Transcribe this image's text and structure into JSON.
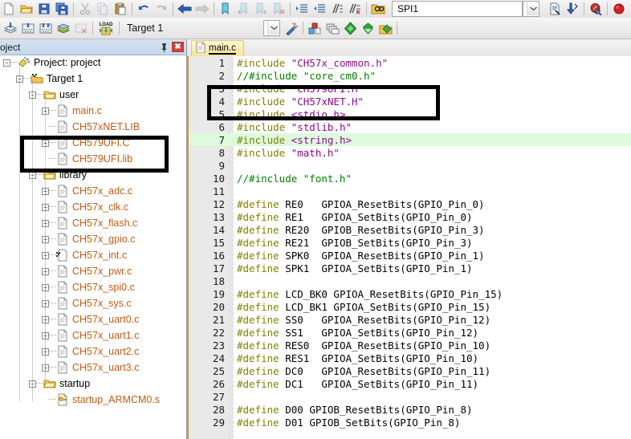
{
  "toolbar_top": {
    "groups": [
      {
        "name": "file",
        "buttons": [
          {
            "name": "new-file-icon",
            "title": "New",
            "icon": "page"
          },
          {
            "name": "open-folder-icon",
            "title": "Open",
            "icon": "folder"
          },
          {
            "name": "save-icon",
            "title": "Save",
            "icon": "floppy"
          },
          {
            "name": "save-all-icon",
            "title": "Save All",
            "icon": "floppy-multi"
          }
        ]
      },
      {
        "name": "clipboard",
        "buttons": [
          {
            "name": "cut-icon",
            "title": "Cut",
            "icon": "scissors"
          },
          {
            "name": "copy-icon",
            "title": "Copy",
            "icon": "copy"
          },
          {
            "name": "paste-icon",
            "title": "Paste",
            "icon": "paste"
          }
        ]
      },
      {
        "name": "history",
        "buttons": [
          {
            "name": "undo-icon",
            "title": "Undo",
            "icon": "undo"
          },
          {
            "name": "redo-icon",
            "title": "Redo",
            "icon": "redo"
          }
        ]
      },
      {
        "name": "navigate",
        "buttons": [
          {
            "name": "navigate-back-icon",
            "title": "Back",
            "icon": "arrow-left"
          },
          {
            "name": "navigate-forward-icon",
            "title": "Forward",
            "icon": "arrow-right"
          }
        ]
      },
      {
        "name": "bookmarks",
        "buttons": [
          {
            "name": "toggle-bookmark-icon",
            "title": "Insert/Remove Bookmark",
            "icon": "bookmark"
          },
          {
            "name": "prev-bookmark-icon",
            "title": "Previous Bookmark",
            "icon": "bookmark-prev"
          },
          {
            "name": "next-bookmark-icon",
            "title": "Next Bookmark",
            "icon": "bookmark-next"
          },
          {
            "name": "clear-bookmarks-icon",
            "title": "Clear All Bookmarks",
            "icon": "bookmark-clear"
          }
        ]
      },
      {
        "name": "indent",
        "buttons": [
          {
            "name": "indent-icon",
            "title": "Indent",
            "icon": "indent"
          },
          {
            "name": "outdent-icon",
            "title": "Outdent",
            "icon": "outdent"
          },
          {
            "name": "comment-icon",
            "title": "Comment",
            "icon": "comment"
          },
          {
            "name": "uncomment-icon",
            "title": "Uncomment",
            "icon": "uncomment"
          }
        ]
      },
      {
        "name": "find",
        "buttons": [
          {
            "name": "find-in-files-icon",
            "title": "Find in Files",
            "icon": "binoculars"
          }
        ]
      }
    ],
    "search_value": "SPI1",
    "search_placeholder": "",
    "right_buttons": [
      {
        "name": "browse-symbol-icon",
        "title": "Browse Code",
        "icon": "doc-search"
      },
      {
        "name": "go-to-definition-icon",
        "title": "Go To Definition",
        "icon": "goto-def"
      },
      {
        "name": "debug-search-icon",
        "title": "Find Symbol",
        "icon": "q-search"
      },
      {
        "name": "stop-icon",
        "title": "Stop",
        "icon": "stop-red"
      }
    ]
  },
  "toolbar_second": {
    "buttons": [
      {
        "name": "build-icon",
        "title": "Translate",
        "icon": "translate"
      },
      {
        "name": "build-target-icon",
        "title": "Build",
        "icon": "build"
      },
      {
        "name": "rebuild-icon",
        "title": "Rebuild",
        "icon": "rebuild"
      },
      {
        "name": "batch-build-icon",
        "title": "Batch Build",
        "icon": "batch"
      },
      {
        "name": "stop-build-icon",
        "title": "Stop Build",
        "icon": "stop-build"
      },
      {
        "name": "download-icon",
        "title": "Download",
        "icon": "load"
      }
    ],
    "target_label": "Target 1",
    "after_combo_buttons": [
      {
        "name": "target-options-icon",
        "title": "Configure Target",
        "icon": "wand"
      },
      {
        "name": "manage-components-icon",
        "title": "Manage Components",
        "icon": "components"
      },
      {
        "name": "multi-project-icon",
        "title": "Multi-Project",
        "icon": "multi"
      },
      {
        "name": "pack-installer-icon",
        "title": "Pack Installer",
        "icon": "diamond"
      },
      {
        "name": "manage-rte-icon",
        "title": "Manage Run-Time Env",
        "icon": "rte"
      },
      {
        "name": "pack-browse-icon",
        "title": "Select Software Packs",
        "icon": "packs"
      }
    ]
  },
  "project_panel": {
    "title": "roject",
    "pin_icon": "pin-icon",
    "close_icon": "close-icon",
    "tree": [
      {
        "depth": 0,
        "label": "Project: project",
        "expander": "minus",
        "icon": "project",
        "type": "root"
      },
      {
        "depth": 1,
        "label": "Target 1",
        "expander": "minus",
        "icon": "target",
        "type": "target"
      },
      {
        "depth": 2,
        "label": "user",
        "expander": "minus",
        "icon": "folder",
        "type": "group"
      },
      {
        "depth": 3,
        "label": "main.c",
        "expander": "plus",
        "icon": "file",
        "type": "source"
      },
      {
        "depth": 3,
        "label": "CH57xNET.LIB",
        "expander": "none",
        "icon": "file",
        "type": "source"
      },
      {
        "depth": 3,
        "label": "CH579UFI.C",
        "expander": "plus",
        "icon": "file",
        "type": "source"
      },
      {
        "depth": 3,
        "label": "CH579UFI.lib",
        "expander": "none",
        "icon": "file",
        "type": "source"
      },
      {
        "depth": 2,
        "label": "library",
        "expander": "minus",
        "icon": "folder",
        "type": "group"
      },
      {
        "depth": 3,
        "label": "CH57x_adc.c",
        "expander": "plus",
        "icon": "file",
        "type": "source"
      },
      {
        "depth": 3,
        "label": "CH57x_clk.c",
        "expander": "plus",
        "icon": "file",
        "type": "source"
      },
      {
        "depth": 3,
        "label": "CH57x_flash.c",
        "expander": "plus",
        "icon": "file",
        "type": "source"
      },
      {
        "depth": 3,
        "label": "CH57x_gpio.c",
        "expander": "plus",
        "icon": "file",
        "type": "source"
      },
      {
        "depth": 3,
        "label": "CH57x_int.c",
        "expander": "plus",
        "icon": "file-target",
        "type": "source"
      },
      {
        "depth": 3,
        "label": "CH57x_pwr.c",
        "expander": "plus",
        "icon": "file",
        "type": "source"
      },
      {
        "depth": 3,
        "label": "CH57x_spi0.c",
        "expander": "plus",
        "icon": "file",
        "type": "source"
      },
      {
        "depth": 3,
        "label": "CH57x_sys.c",
        "expander": "plus",
        "icon": "file",
        "type": "source"
      },
      {
        "depth": 3,
        "label": "CH57x_uart0.c",
        "expander": "plus",
        "icon": "file",
        "type": "source"
      },
      {
        "depth": 3,
        "label": "CH57x_uart1.c",
        "expander": "plus",
        "icon": "file",
        "type": "source"
      },
      {
        "depth": 3,
        "label": "CH57x_uart2.c",
        "expander": "plus",
        "icon": "file",
        "type": "source"
      },
      {
        "depth": 3,
        "label": "CH57x_uart3.c",
        "expander": "plus",
        "icon": "file",
        "type": "source"
      },
      {
        "depth": 2,
        "label": "startup",
        "expander": "minus",
        "icon": "folder",
        "type": "group"
      },
      {
        "depth": 3,
        "label": "startup_ARMCM0.s",
        "expander": "none",
        "icon": "file-asm",
        "type": "asm"
      }
    ]
  },
  "editor": {
    "tab_label": "main.c",
    "tab_icon": "file-icon",
    "highlight_line": 7,
    "lines": [
      {
        "n": 1,
        "tokens": [
          {
            "t": "#include ",
            "c": "pp"
          },
          {
            "t": "\"CH57x_common.h\"",
            "c": "str"
          }
        ]
      },
      {
        "n": 2,
        "tokens": [
          {
            "t": "//#include \"core_cm0.h\"",
            "c": "cmt"
          }
        ]
      },
      {
        "n": 3,
        "tokens": [
          {
            "t": "#include ",
            "c": "pp"
          },
          {
            "t": "\"CH579UFI.H\"",
            "c": "str"
          }
        ]
      },
      {
        "n": 4,
        "tokens": [
          {
            "t": "#include ",
            "c": "pp"
          },
          {
            "t": "\"CH57xNET.H\"",
            "c": "str"
          }
        ]
      },
      {
        "n": 5,
        "tokens": [
          {
            "t": "#include ",
            "c": "pp"
          },
          {
            "t": "<stdio.h>",
            "c": "str"
          }
        ]
      },
      {
        "n": 6,
        "tokens": [
          {
            "t": "#include ",
            "c": "pp"
          },
          {
            "t": "\"stdlib.h\"",
            "c": "str"
          }
        ]
      },
      {
        "n": 7,
        "tokens": [
          {
            "t": "#include ",
            "c": "pp"
          },
          {
            "t": "<string.h>",
            "c": "str"
          }
        ]
      },
      {
        "n": 8,
        "tokens": [
          {
            "t": "#include ",
            "c": "pp"
          },
          {
            "t": "\"math.h\"",
            "c": "str"
          }
        ]
      },
      {
        "n": 9,
        "tokens": []
      },
      {
        "n": 10,
        "tokens": [
          {
            "t": "//#include \"font.h\"",
            "c": "cmt"
          }
        ]
      },
      {
        "n": 11,
        "tokens": []
      },
      {
        "n": 12,
        "tokens": [
          {
            "t": "#define ",
            "c": "pp"
          },
          {
            "t": "RE0   GPIOA_ResetBits(GPIO_Pin_0)",
            "c": "txt"
          }
        ]
      },
      {
        "n": 13,
        "tokens": [
          {
            "t": "#define ",
            "c": "pp"
          },
          {
            "t": "RE1   GPIOA_SetBits(GPIO_Pin_0)",
            "c": "txt"
          }
        ]
      },
      {
        "n": 14,
        "tokens": [
          {
            "t": "#define ",
            "c": "pp"
          },
          {
            "t": "RE20  GPIOB_ResetBits(GPIO_Pin_3)",
            "c": "txt"
          }
        ]
      },
      {
        "n": 15,
        "tokens": [
          {
            "t": "#define ",
            "c": "pp"
          },
          {
            "t": "RE21  GPIOB_SetBits(GPIO_Pin_3)",
            "c": "txt"
          }
        ]
      },
      {
        "n": 16,
        "tokens": [
          {
            "t": "#define ",
            "c": "pp"
          },
          {
            "t": "SPK0  GPIOA_ResetBits(GPIO_Pin_1)",
            "c": "txt"
          }
        ]
      },
      {
        "n": 17,
        "tokens": [
          {
            "t": "#define ",
            "c": "pp"
          },
          {
            "t": "SPK1  GPIOA_SetBits(GPIO_Pin_1)",
            "c": "txt"
          }
        ]
      },
      {
        "n": 18,
        "tokens": []
      },
      {
        "n": 19,
        "tokens": [
          {
            "t": "#define ",
            "c": "pp"
          },
          {
            "t": "LCD_BK0 GPIOA_ResetBits(GPIO_Pin_15)",
            "c": "txt"
          }
        ]
      },
      {
        "n": 20,
        "tokens": [
          {
            "t": "#define ",
            "c": "pp"
          },
          {
            "t": "LCD_BK1 GPIOA_SetBits(GPIO_Pin_15)",
            "c": "txt"
          }
        ]
      },
      {
        "n": 21,
        "tokens": [
          {
            "t": "#define ",
            "c": "pp"
          },
          {
            "t": "SS0   GPIOA_ResetBits(GPIO_Pin_12)",
            "c": "txt"
          }
        ]
      },
      {
        "n": 22,
        "tokens": [
          {
            "t": "#define ",
            "c": "pp"
          },
          {
            "t": "SS1   GPIOA_SetBits(GPIO_Pin_12)",
            "c": "txt"
          }
        ]
      },
      {
        "n": 23,
        "tokens": [
          {
            "t": "#define ",
            "c": "pp"
          },
          {
            "t": "RES0  GPIOA_ResetBits(GPIO_Pin_10)",
            "c": "txt"
          }
        ]
      },
      {
        "n": 24,
        "tokens": [
          {
            "t": "#define ",
            "c": "pp"
          },
          {
            "t": "RES1  GPIOA_SetBits(GPIO_Pin_10)",
            "c": "txt"
          }
        ]
      },
      {
        "n": 25,
        "tokens": [
          {
            "t": "#define ",
            "c": "pp"
          },
          {
            "t": "DC0   GPIOA_ResetBits(GPIO_Pin_11)",
            "c": "txt"
          }
        ]
      },
      {
        "n": 26,
        "tokens": [
          {
            "t": "#define ",
            "c": "pp"
          },
          {
            "t": "DC1   GPIOA_SetBits(GPIO_Pin_11)",
            "c": "txt"
          }
        ]
      },
      {
        "n": 27,
        "tokens": []
      },
      {
        "n": 28,
        "tokens": [
          {
            "t": "#define ",
            "c": "pp"
          },
          {
            "t": "D00 GPIOB_ResetBits(GPIO_Pin_8)",
            "c": "txt"
          }
        ]
      },
      {
        "n": 29,
        "tokens": [
          {
            "t": "#define ",
            "c": "pp"
          },
          {
            "t": "D01 GPIOB_SetBits(GPIO_Pin_8)",
            "c": "txt"
          }
        ]
      }
    ]
  },
  "annotations": [
    {
      "name": "annotation-box-tree",
      "target": "CH579UFI.C / CH579UFI.lib"
    },
    {
      "name": "annotation-box-code",
      "target": "lines 3-4 includes"
    }
  ],
  "colors": {
    "preprocessor": "#808000",
    "string": "#8b0a8b",
    "comment": "#008000",
    "source_file": "#c35a11",
    "highlight_line": "#ddfadd",
    "annotation": "#000000",
    "close_button": "#c9473f"
  }
}
